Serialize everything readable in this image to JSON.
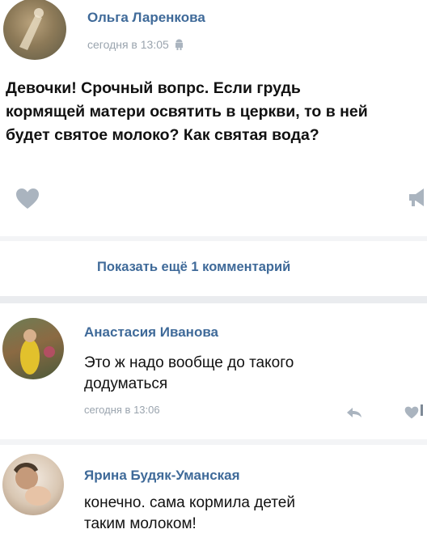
{
  "post": {
    "author": "Ольга Ларенкова",
    "time": "сегодня в 13:05",
    "text_lines": [
      "Девочки! Срочный вопрс. Если грудь",
      "кормящей матери освятить в церкви, то в ней",
      "будет святое молоко? Как святая вода?"
    ]
  },
  "show_more": "Показать ещё 1 комментарий",
  "comments": [
    {
      "author": "Анастасия Иванова",
      "text_lines": [
        "Это ж надо вообще до такого",
        "додуматься"
      ],
      "time": "сегодня в 13:06"
    },
    {
      "author": "Ярина Будяк-Уманская",
      "text_lines": [
        "конечно. сама кормила детей",
        "таким молоком!"
      ]
    }
  ],
  "colors": {
    "link": "#3f6a99",
    "meta": "#9aa4ae",
    "icon": "#aab4bf",
    "divider": "#eaecef"
  }
}
